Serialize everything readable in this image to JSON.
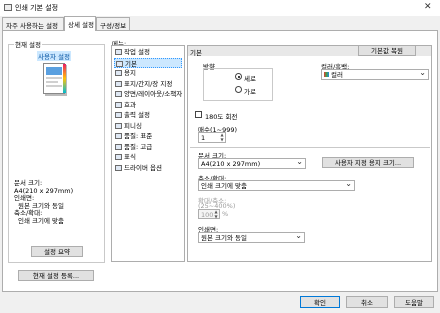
{
  "window": {
    "title": "인쇄 기본 설정",
    "close": "✕"
  },
  "tabs": [
    {
      "label": "자주 사용하는 설정"
    },
    {
      "label": "상세 설정"
    },
    {
      "label": "구성/정보"
    }
  ],
  "left_panel": {
    "group_label": "현재 설정",
    "preview_label": "사용자 설정",
    "summary_lines": [
      "문서 크기:",
      "A4(210 x 297mm)",
      "인쇄면:",
      "원본 크기와 동일",
      "축소/확대:",
      "인쇄 크기에 맞춤"
    ],
    "summary_button": "설정 요약",
    "register_button": "현재 설정 등록..."
  },
  "menu": {
    "label": "메뉴:",
    "items": [
      "작업 설정",
      "기본",
      "용지",
      "표지/간지/장 지정",
      "양면/레이아웃/소책자",
      "효과",
      "출력 설정",
      "피니싱",
      "품질: 표준",
      "품질: 고급",
      "표식",
      "드라이버 옵션"
    ],
    "selected_index": 1
  },
  "basic": {
    "header": "기본",
    "restore_button": "기본값 복원",
    "orientation": {
      "label": "방향",
      "options": [
        "세로",
        "가로"
      ],
      "selected": "세로"
    },
    "color": {
      "label": "컬러/흑백:",
      "value": "컬러"
    },
    "rotate180": {
      "label": "180도 회전",
      "checked": false
    },
    "copies": {
      "label": "매수(1~999)",
      "value": "1"
    },
    "doc_size": {
      "label": "문서 크기:",
      "value": "A4(210 x 297mm)"
    },
    "custom_paper_button": "사용자 지정 용지 크기...",
    "scale": {
      "label": "축소/확대:",
      "value": "인쇄 크기에 맞춤"
    },
    "zoom": {
      "label": "확대/축소:",
      "range": "(25~400%)",
      "value": "100"
    },
    "print_size": {
      "label": "인쇄면:",
      "value": "원본 크기와 동일"
    }
  },
  "footer": {
    "ok": "확인",
    "cancel": "취소",
    "help": "도움말"
  }
}
